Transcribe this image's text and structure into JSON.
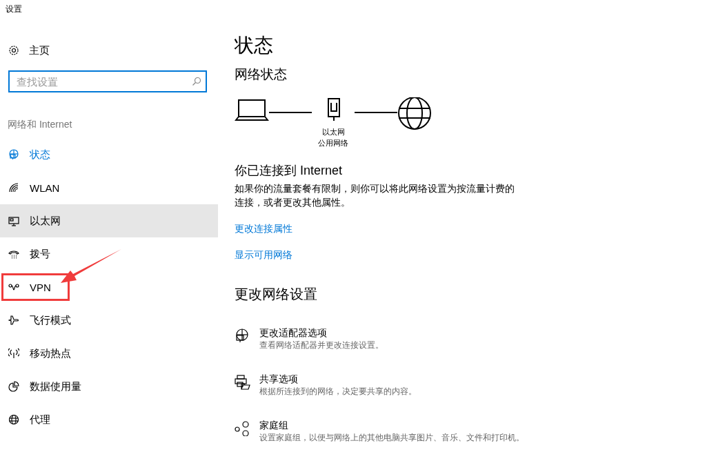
{
  "window": {
    "title": "设置"
  },
  "sidebar": {
    "home": {
      "label": "主页"
    },
    "search": {
      "placeholder": "查找设置"
    },
    "section_title": "网络和 Internet",
    "items": [
      {
        "label": "状态",
        "kind": "status",
        "selected": true,
        "hovered": false
      },
      {
        "label": "WLAN",
        "kind": "wifi",
        "selected": false,
        "hovered": false
      },
      {
        "label": "以太网",
        "kind": "ethernet",
        "selected": false,
        "hovered": true
      },
      {
        "label": "拨号",
        "kind": "dialup",
        "selected": false,
        "hovered": false
      },
      {
        "label": "VPN",
        "kind": "vpn",
        "selected": false,
        "hovered": false,
        "annotated": true
      },
      {
        "label": "飞行模式",
        "kind": "airplane",
        "selected": false,
        "hovered": false
      },
      {
        "label": "移动热点",
        "kind": "hotspot",
        "selected": false,
        "hovered": false
      },
      {
        "label": "数据使用量",
        "kind": "data",
        "selected": false,
        "hovered": false
      },
      {
        "label": "代理",
        "kind": "proxy",
        "selected": false,
        "hovered": false
      }
    ]
  },
  "main": {
    "title": "状态",
    "network_status": {
      "heading": "网络状态",
      "adapter_label": "以太网",
      "network_label": "公用网络"
    },
    "connected_heading": "你已连接到 Internet",
    "connected_text": "如果你的流量套餐有限制，则你可以将此网络设置为按流量计费的连接，或者更改其他属性。",
    "links": [
      "更改连接属性",
      "显示可用网络"
    ],
    "change_heading": "更改网络设置",
    "options": [
      {
        "kind": "adapter",
        "title": "更改适配器选项",
        "description": "查看网络适配器并更改连接设置。"
      },
      {
        "kind": "sharing",
        "title": "共享选项",
        "description": "根据所连接到的网络，决定要共享的内容。"
      },
      {
        "kind": "homegroup",
        "title": "家庭组",
        "description": "设置家庭组，以便与网络上的其他电脑共享图片、音乐、文件和打印机。"
      }
    ]
  }
}
